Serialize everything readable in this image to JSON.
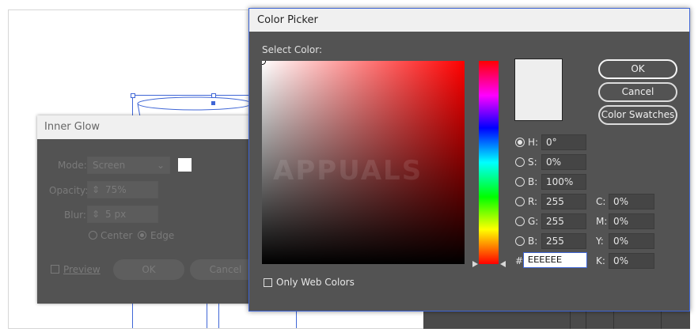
{
  "artboard": {},
  "inner_glow": {
    "title": "Inner Glow",
    "mode_label": "Mode:",
    "mode_value": "Screen",
    "opacity_label": "Opacity:",
    "opacity_value": "75%",
    "blur_label": "Blur:",
    "blur_value": "5 px",
    "center_label": "Center",
    "edge_label": "Edge",
    "preview_label": "Preview",
    "ok_label": "OK",
    "cancel_label": "Cancel"
  },
  "picker": {
    "title": "Color Picker",
    "select_color_label": "Select Color:",
    "ok_label": "OK",
    "cancel_label": "Cancel",
    "swatches_label": "Color Swatches",
    "current_color": "#EEEEEE",
    "hsb": [
      {
        "label": "H:",
        "value": "0°",
        "selected": true
      },
      {
        "label": "S:",
        "value": "0%",
        "selected": false
      },
      {
        "label": "B:",
        "value": "100%",
        "selected": false
      }
    ],
    "rgb": [
      {
        "label": "R:",
        "value": "255"
      },
      {
        "label": "G:",
        "value": "255"
      },
      {
        "label": "B:",
        "value": "255"
      }
    ],
    "cmyk": [
      {
        "label": "C:",
        "value": "0%"
      },
      {
        "label": "M:",
        "value": "0%"
      },
      {
        "label": "Y:",
        "value": "0%"
      },
      {
        "label": "K:",
        "value": "0%"
      }
    ],
    "hex_prefix": "#",
    "hex_value": "EEEEEE",
    "only_web_colors_label": "Only Web Colors",
    "watermark": "APPUALS"
  }
}
